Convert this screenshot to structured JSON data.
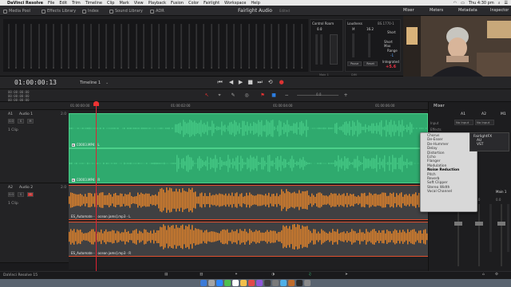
{
  "menubar": {
    "app": "DaVinci Resolve",
    "items": [
      "File",
      "Edit",
      "Trim",
      "Timeline",
      "Clip",
      "Mark",
      "View",
      "Playback",
      "Fusion",
      "Color",
      "Fairlight",
      "Workspace",
      "Help"
    ],
    "clock": "Thu 4:30 pm"
  },
  "toolbar": {
    "left": [
      "Media Pool",
      "Effects Library",
      "Index",
      "Sound Library",
      "ADR"
    ],
    "title": "Fairlight Audio",
    "edited": "Edited",
    "right": [
      "Mixer",
      "Meters",
      "Metadata",
      "Inspector"
    ]
  },
  "monitor": {
    "control_room": "Control Room",
    "control_level": "0.0",
    "loudness": "Loudness",
    "standard": "BS.1770-1",
    "m_label": "M",
    "m_value": "16.2",
    "short": "Short",
    "short_max": "Short Max",
    "range": "Range",
    "range_value": "-1",
    "integrated": "Integrated",
    "integrated_value": "+5.6",
    "pause": "Pause",
    "reset": "Reset",
    "m1": "M1",
    "main": "Main 1",
    "dim": "DIM"
  },
  "transport": {
    "timecode": "01:00:00:13",
    "timeline_name": "Timeline 1"
  },
  "tools": {
    "row1": "00:00:00:00",
    "row2": "00:00:00:00",
    "row3": "00:00:00:00",
    "zoom_value": "0.0"
  },
  "ruler": {
    "labels": [
      "01:00:00:00",
      "01:00:02:00",
      "01:00:04:00",
      "01:00:06:00"
    ]
  },
  "tracks": [
    {
      "id": "A1",
      "name": "Audio 1",
      "format": "2.0",
      "clips": "1 Clip"
    },
    {
      "id": "A2",
      "name": "Audio 2",
      "format": "2.0",
      "clips": "1 Clip"
    }
  ],
  "clips": {
    "a1_top": "C0003.MP4 - L",
    "a1_bottom": "C0003.MP4 - R",
    "a2_top": "ES_Automate - [ ocean jams].mp3 - L",
    "a2_bottom": "ES_Automate - [ ocean jams].mp3 - R"
  },
  "mixer": {
    "title": "Mixer",
    "channels": [
      "A1",
      "A2",
      "M1"
    ],
    "input_label": "Input",
    "input_values": [
      "No Input",
      "No Input"
    ],
    "effects_label": "Effects",
    "fx_items": [
      "FairlightFX",
      "AU",
      "VST"
    ],
    "strip_names": [
      "Audio 2",
      "Main 1"
    ],
    "fader_values": [
      "0.0",
      "0.0"
    ]
  },
  "context_menu": {
    "items": [
      "Chorus",
      "De-Esser",
      "De-Hummer",
      "Delay",
      "Distortion",
      "Echo",
      "Flanger",
      "Modulation",
      "Noise Reduction",
      "Pitch",
      "Reverb",
      "Soft Clipper",
      "Stereo Width",
      "Vocal Channel"
    ],
    "highlighted": "Noise Reduction"
  },
  "statusbar": {
    "app": "DaVinci Resolve 15"
  },
  "colors": {
    "audio1_clip": "#2faa6e",
    "audio2_wave": "#e8862a",
    "playhead": "#dd2233"
  }
}
